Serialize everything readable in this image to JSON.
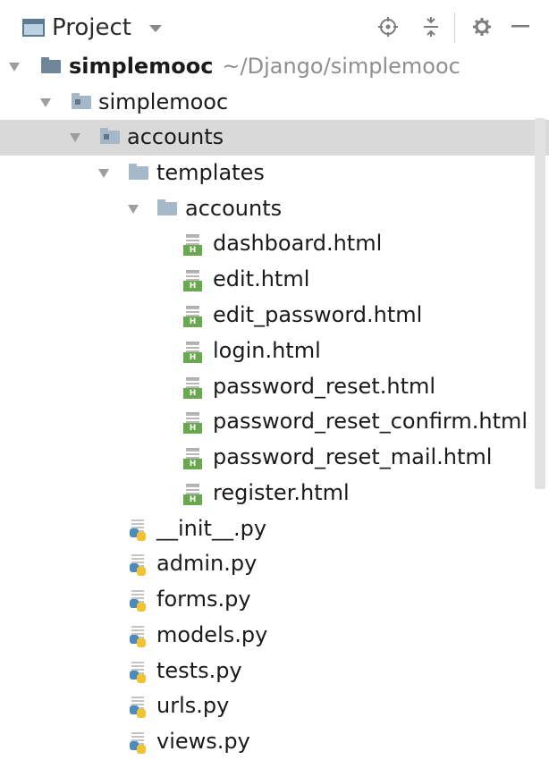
{
  "toolbar": {
    "title": "Project",
    "icons": [
      "locate-icon",
      "collapse-all-icon",
      "settings-icon",
      "minimize-icon"
    ]
  },
  "tree": {
    "root": {
      "label": "simplemooc",
      "path_hint": "~/Django/simplemooc"
    },
    "app_folder": "simplemooc",
    "accounts_folder": "accounts",
    "templates_folder": "templates",
    "templates_accounts_folder": "accounts",
    "html_files": [
      "dashboard.html",
      "edit.html",
      "edit_password.html",
      "login.html",
      "password_reset.html",
      "password_reset_confirm.html",
      "password_reset_mail.html",
      "register.html"
    ],
    "py_files": [
      "__init__.py",
      "admin.py",
      "forms.py",
      "models.py",
      "tests.py",
      "urls.py",
      "views.py"
    ]
  },
  "selected_item": "accounts",
  "colors": {
    "selection": "#d9d9d9",
    "html_badge": "#6aa84f",
    "python_blue": "#4b8bbe",
    "python_yellow": "#f2c230",
    "path_hint": "#8f8f8f"
  }
}
